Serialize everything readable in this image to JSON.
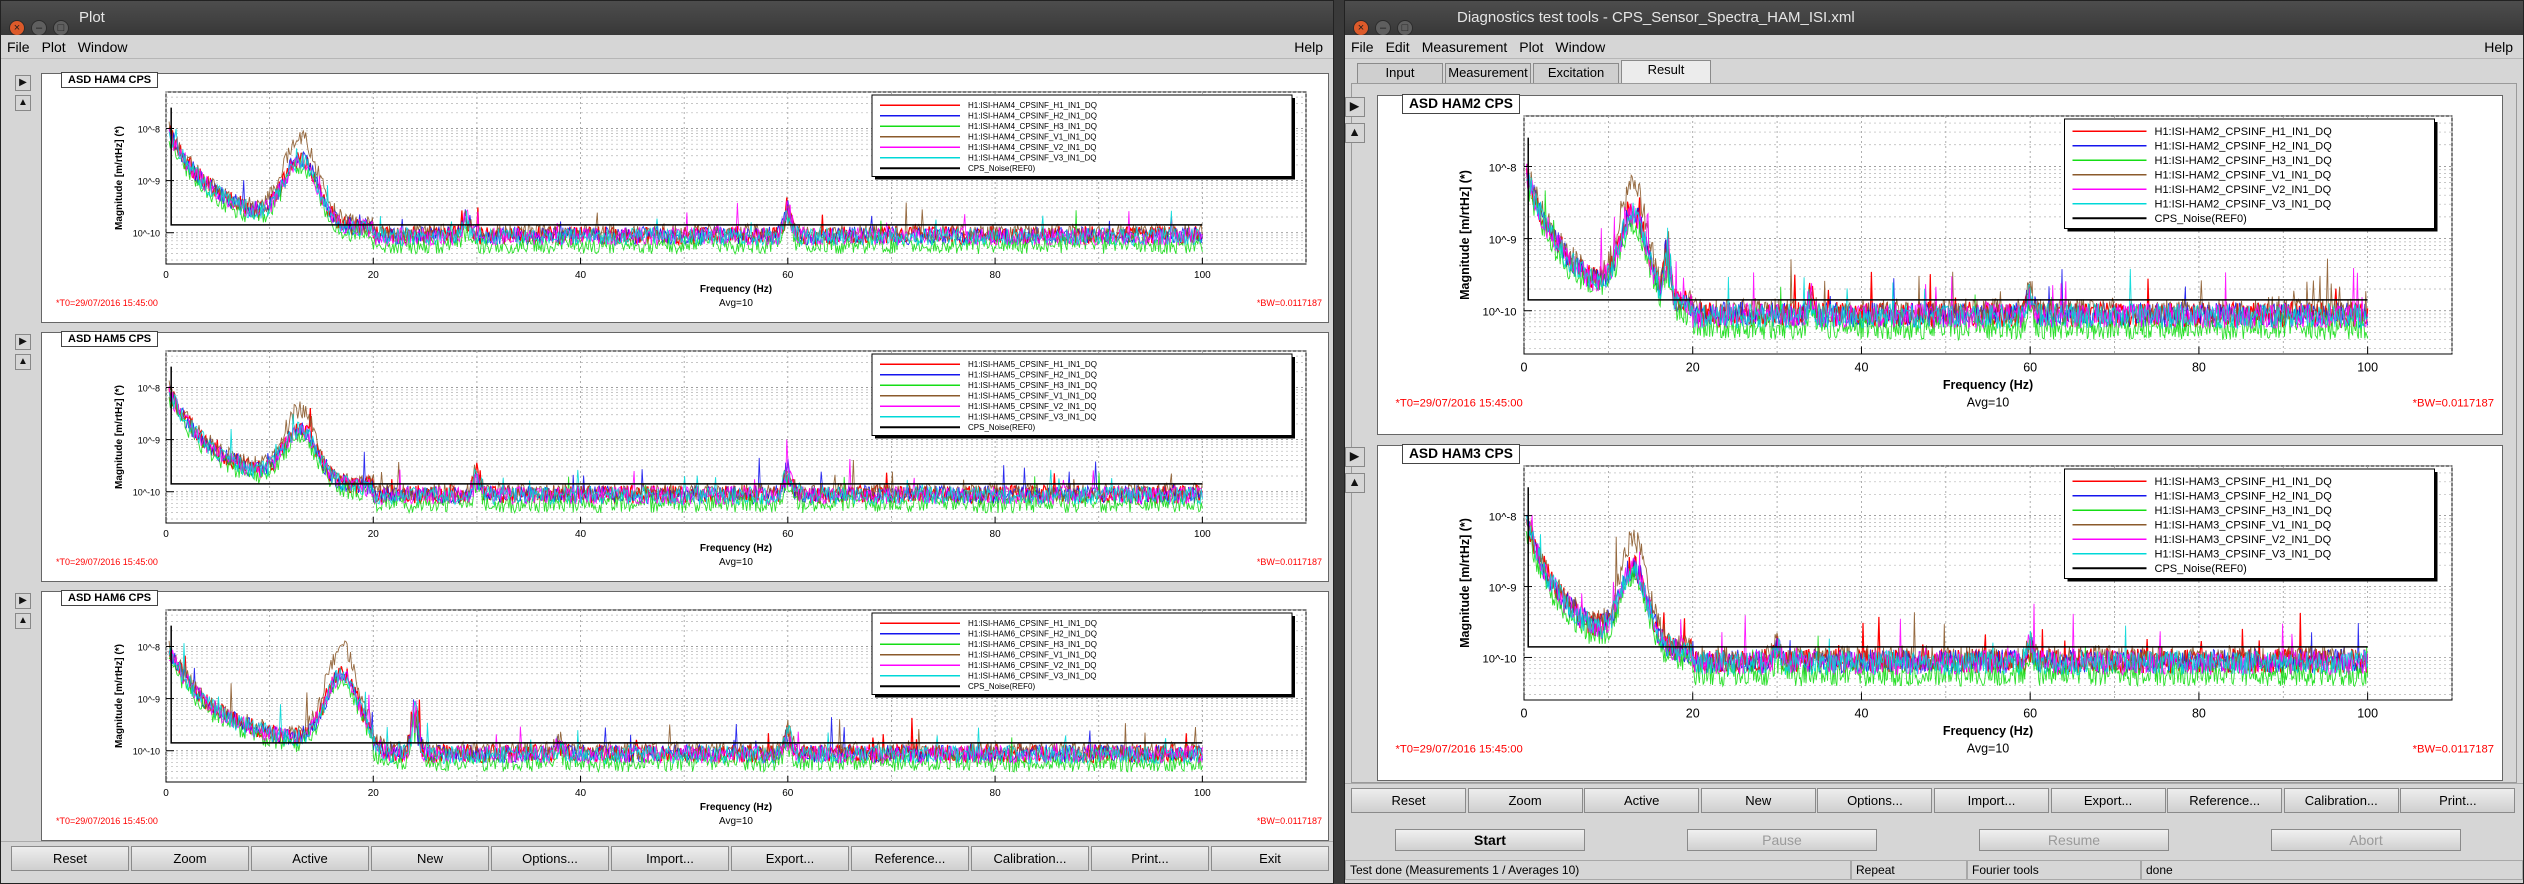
{
  "plot_window": {
    "title": "Plot",
    "menu": [
      "File",
      "Plot",
      "Window"
    ],
    "help": "Help",
    "buttons": [
      "Reset",
      "Zoom",
      "Active",
      "New",
      "Options...",
      "Import...",
      "Export...",
      "Reference...",
      "Calibration...",
      "Print...",
      "Exit"
    ]
  },
  "diag_window": {
    "title": "Diagnostics test tools - CPS_Sensor_Spectra_HAM_ISI.xml",
    "menu": [
      "File",
      "Edit",
      "Measurement",
      "Plot",
      "Window"
    ],
    "help": "Help",
    "tabs": [
      "Input",
      "Measurement",
      "Excitation",
      "Result"
    ],
    "active_tab": "Result",
    "buttons": [
      "Reset",
      "Zoom",
      "Active",
      "New",
      "Options...",
      "Import...",
      "Export...",
      "Reference...",
      "Calibration...",
      "Print..."
    ],
    "controls": [
      {
        "label": "Start",
        "enabled": true
      },
      {
        "label": "Pause",
        "enabled": false
      },
      {
        "label": "Resume",
        "enabled": false
      },
      {
        "label": "Abort",
        "enabled": false
      }
    ],
    "status": {
      "message": "Test done (Measurements 1 / Averages 10)",
      "mode": "Repeat",
      "tool": "Fourier tools",
      "state": "done"
    }
  },
  "colors": {
    "ch1": "#ff0000",
    "ch2": "#1515ee",
    "ch3": "#15dd15",
    "ch4": "#8b5a2b",
    "ch5": "#ff00ff",
    "ch6": "#00d8d8",
    "ref": "#000000",
    "info_red": "#ff0000"
  },
  "chart_data": [
    {
      "type": "line",
      "id": "ham4",
      "title": "ASD HAM4 CPS",
      "xlabel": "Frequency (Hz)",
      "ylabel": "Magnitude [m/rtHz] (*)",
      "xticks": [
        "0",
        "20",
        "40",
        "60",
        "80",
        "100"
      ],
      "yticks": [
        "10^-8",
        "10^-9",
        "10^-10"
      ],
      "xlim": [
        0,
        110
      ],
      "ylog": true,
      "ylim_exp": [
        -10.6,
        -7.3
      ],
      "grid": true,
      "legend_position": "top-right",
      "series_names": [
        "H1:ISI-HAM4_CPSINF_H1_IN1_DQ",
        "H1:ISI-HAM4_CPSINF_H2_IN1_DQ",
        "H1:ISI-HAM4_CPSINF_H3_IN1_DQ",
        "H1:ISI-HAM4_CPSINF_V1_IN1_DQ",
        "H1:ISI-HAM4_CPSINF_V2_IN1_DQ",
        "H1:ISI-HAM4_CPSINF_V3_IN1_DQ",
        "CPS_Noise(REF0)"
      ],
      "t0": "*T0=29/07/2016 15:45:00",
      "avg": "Avg=10",
      "bw": "*BW=0.0117187",
      "peaks": [
        [
          13,
          -8.3
        ],
        [
          60,
          -9.1
        ],
        [
          29,
          -9.4
        ]
      ]
    },
    {
      "type": "line",
      "id": "ham5",
      "title": "ASD HAM5 CPS",
      "xlabel": "Frequency (Hz)",
      "ylabel": "Magnitude [m/rtHz] (*)",
      "xticks": [
        "0",
        "20",
        "40",
        "60",
        "80",
        "100"
      ],
      "yticks": [
        "10^-8",
        "10^-9",
        "10^-10"
      ],
      "xlim": [
        0,
        110
      ],
      "ylog": true,
      "ylim_exp": [
        -10.6,
        -7.3
      ],
      "grid": true,
      "legend_position": "top-right",
      "series_names": [
        "H1:ISI-HAM5_CPSINF_H1_IN1_DQ",
        "H1:ISI-HAM5_CPSINF_H2_IN1_DQ",
        "H1:ISI-HAM5_CPSINF_H3_IN1_DQ",
        "H1:ISI-HAM5_CPSINF_V1_IN1_DQ",
        "H1:ISI-HAM5_CPSINF_V2_IN1_DQ",
        "H1:ISI-HAM5_CPSINF_V3_IN1_DQ",
        "CPS_Noise(REF0)"
      ],
      "t0": "*T0=29/07/2016 15:45:00",
      "avg": "Avg=10",
      "bw": "*BW=0.0117187",
      "peaks": [
        [
          13,
          -8.6
        ],
        [
          60,
          -9.2
        ],
        [
          30,
          -9.3
        ]
      ]
    },
    {
      "type": "line",
      "id": "ham6",
      "title": "ASD HAM6 CPS",
      "xlabel": "Frequency (Hz)",
      "ylabel": "Magnitude [m/rtHz] (*)",
      "xticks": [
        "0",
        "20",
        "40",
        "60",
        "80",
        "100"
      ],
      "yticks": [
        "10^-8",
        "10^-9",
        "10^-10"
      ],
      "xlim": [
        0,
        110
      ],
      "ylog": true,
      "ylim_exp": [
        -10.6,
        -7.3
      ],
      "grid": true,
      "legend_position": "top-right",
      "series_names": [
        "H1:ISI-HAM6_CPSINF_H1_IN1_DQ",
        "H1:ISI-HAM6_CPSINF_H2_IN1_DQ",
        "H1:ISI-HAM6_CPSINF_H3_IN1_DQ",
        "H1:ISI-HAM6_CPSINF_V1_IN1_DQ",
        "H1:ISI-HAM6_CPSINF_V2_IN1_DQ",
        "H1:ISI-HAM6_CPSINF_V3_IN1_DQ",
        "CPS_Noise(REF0)"
      ],
      "t0": "*T0=29/07/2016 15:45:00",
      "avg": "Avg=10",
      "bw": "*BW=0.0117187",
      "peaks": [
        [
          17,
          -8.1
        ],
        [
          24,
          -8.6
        ],
        [
          60,
          -9.3
        ],
        [
          38,
          -9.6
        ]
      ]
    },
    {
      "type": "line",
      "id": "ham2",
      "title": "ASD HAM2 CPS",
      "xlabel": "Frequency (Hz)",
      "ylabel": "Magnitude [m/rtHz] (*)",
      "xticks": [
        "0",
        "20",
        "40",
        "60",
        "80",
        "100"
      ],
      "yticks": [
        "10^-8",
        "10^-9",
        "10^-10"
      ],
      "xlim": [
        0,
        110
      ],
      "ylog": true,
      "ylim_exp": [
        -10.6,
        -7.3
      ],
      "grid": true,
      "legend_position": "top-right",
      "series_names": [
        "H1:ISI-HAM2_CPSINF_H1_IN1_DQ",
        "H1:ISI-HAM2_CPSINF_H2_IN1_DQ",
        "H1:ISI-HAM2_CPSINF_H3_IN1_DQ",
        "H1:ISI-HAM2_CPSINF_V1_IN1_DQ",
        "H1:ISI-HAM2_CPSINF_V2_IN1_DQ",
        "H1:ISI-HAM2_CPSINF_V3_IN1_DQ",
        "CPS_Noise(REF0)"
      ],
      "t0": "*T0=29/07/2016 15:45:00",
      "avg": "Avg=10",
      "bw": "*BW=0.0117187",
      "peaks": [
        [
          13,
          -8.4
        ],
        [
          17,
          -8.8
        ],
        [
          60,
          -9.4
        ],
        [
          34,
          -9.5
        ]
      ]
    },
    {
      "type": "line",
      "id": "ham3",
      "title": "ASD HAM3 CPS",
      "xlabel": "Frequency (Hz)",
      "ylabel": "Magnitude [m/rtHz] (*)",
      "xticks": [
        "0",
        "20",
        "40",
        "60",
        "80",
        "100"
      ],
      "yticks": [
        "10^-8",
        "10^-9",
        "10^-10"
      ],
      "xlim": [
        0,
        110
      ],
      "ylog": true,
      "ylim_exp": [
        -10.6,
        -7.3
      ],
      "grid": true,
      "legend_position": "top-right",
      "series_names": [
        "H1:ISI-HAM3_CPSINF_H1_IN1_DQ",
        "H1:ISI-HAM3_CPSINF_H2_IN1_DQ",
        "H1:ISI-HAM3_CPSINF_H3_IN1_DQ",
        "H1:ISI-HAM3_CPSINF_V1_IN1_DQ",
        "H1:ISI-HAM3_CPSINF_V2_IN1_DQ",
        "H1:ISI-HAM3_CPSINF_V3_IN1_DQ",
        "CPS_Noise(REF0)"
      ],
      "t0": "*T0=29/07/2016 15:45:00",
      "avg": "Avg=10",
      "bw": "*BW=0.0117187",
      "peaks": [
        [
          13,
          -8.5
        ],
        [
          60,
          -9.5
        ],
        [
          30,
          -9.6
        ]
      ]
    }
  ]
}
